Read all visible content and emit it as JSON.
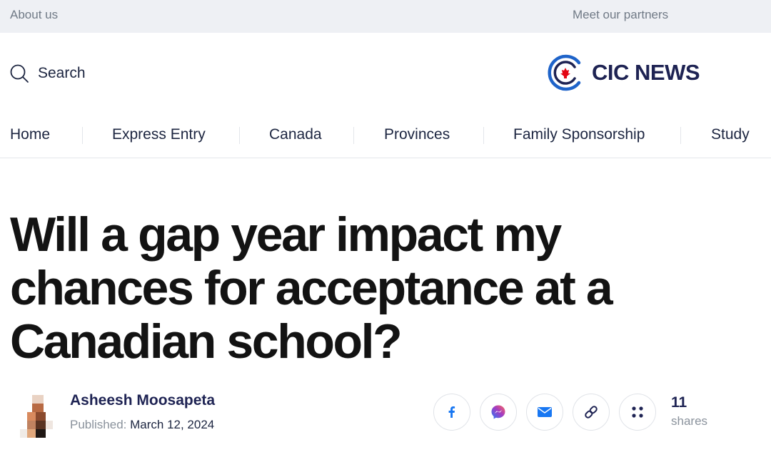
{
  "topbar": {
    "about": "About us",
    "partners": "Meet our partners"
  },
  "search": {
    "label": "Search",
    "icon": "search-icon"
  },
  "logo": {
    "text": "CIC NEWS",
    "icon": "cic-maple-leaf-logo",
    "brand_color": "#1e2353",
    "accent_color": "#e30613"
  },
  "nav": {
    "items": [
      "Home",
      "Express Entry",
      "Canada",
      "Provinces",
      "Family Sponsorship",
      "Study"
    ]
  },
  "article": {
    "title_lines": [
      "Will a gap year impact my",
      "chances for acceptance at a",
      "Canadian school?"
    ],
    "author": "Asheesh Moosapeta",
    "published_label": "Published:",
    "published_date": "March 12, 2024"
  },
  "share": {
    "buttons": [
      "facebook-icon",
      "messenger-icon",
      "email-icon",
      "link-icon",
      "more-icon"
    ],
    "count": "11",
    "count_label": "shares",
    "colors": {
      "facebook": "#1877f2",
      "messenger": "#a33bc2",
      "email": "#1877f2",
      "link": "#1e2353",
      "more": "#1e2353"
    }
  }
}
